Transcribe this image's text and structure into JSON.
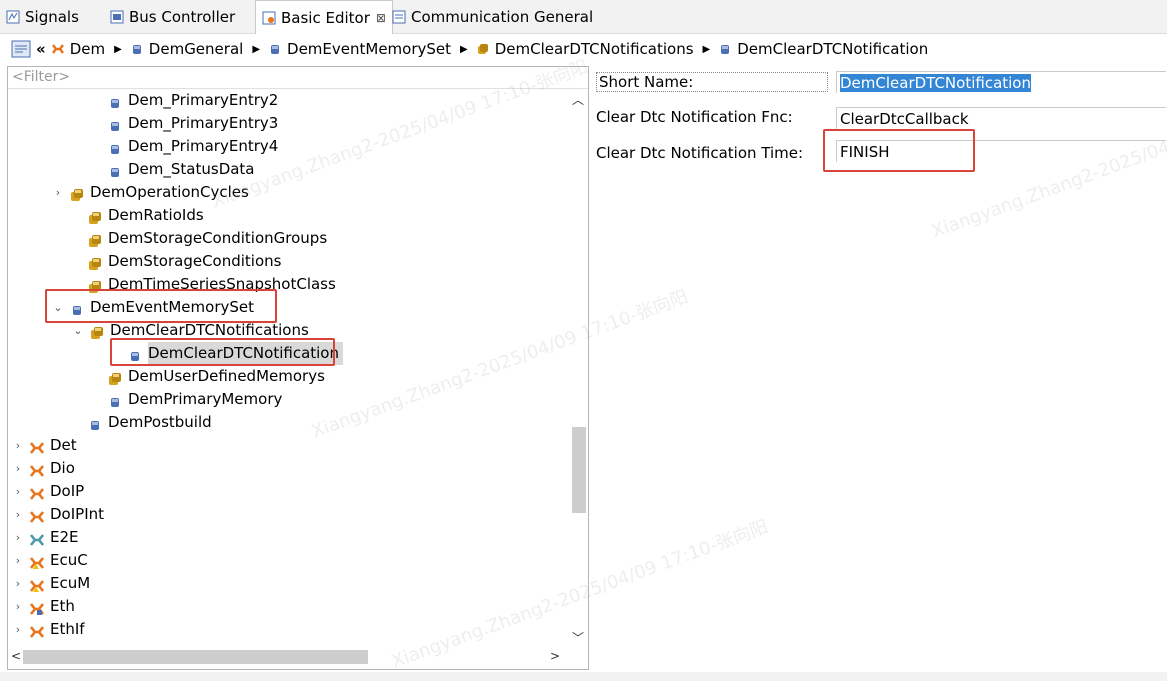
{
  "tabs": [
    {
      "label": "Signals"
    },
    {
      "label": "Bus Controller"
    },
    {
      "label": "Basic Editor",
      "close": "⊠"
    },
    {
      "label": "Communication General"
    }
  ],
  "breadcrumb": {
    "back": "«",
    "items": [
      "Dem",
      "DemGeneral",
      "DemEventMemorySet",
      "DemClearDTCNotifications",
      "DemClearDTCNotification"
    ]
  },
  "filter": {
    "placeholder": "<Filter>"
  },
  "tree": [
    {
      "label": "Dem_PrimaryEntry2"
    },
    {
      "label": "Dem_PrimaryEntry3"
    },
    {
      "label": "Dem_PrimaryEntry4"
    },
    {
      "label": "Dem_StatusData"
    },
    {
      "label": "DemOperationCycles"
    },
    {
      "label": "DemRatioIds"
    },
    {
      "label": "DemStorageConditionGroups"
    },
    {
      "label": "DemStorageConditions"
    },
    {
      "label": "DemTimeSeriesSnapshotClass"
    },
    {
      "label": "DemEventMemorySet"
    },
    {
      "label": "DemClearDTCNotifications"
    },
    {
      "label": "DemClearDTCNotification"
    },
    {
      "label": "DemUserDefinedMemorys"
    },
    {
      "label": "DemPrimaryMemory"
    },
    {
      "label": "DemPostbuild"
    },
    {
      "label": "Det"
    },
    {
      "label": "Dio"
    },
    {
      "label": "DoIP"
    },
    {
      "label": "DoIPInt"
    },
    {
      "label": "E2E"
    },
    {
      "label": "EcuC"
    },
    {
      "label": "EcuM"
    },
    {
      "label": "Eth"
    },
    {
      "label": "EthIf"
    }
  ],
  "form": {
    "short_name_label": "Short Name:",
    "short_name_value": "DemClearDTCNotification",
    "fnc_label": "Clear Dtc Notification Fnc:",
    "fnc_value": "ClearDtcCallback",
    "time_label": "Clear Dtc Notification Time:",
    "time_value": "FINISH"
  },
  "watermark": "Xiangyang.Zhang2-2025/04/09 17:10-张向阳",
  "colors": {
    "highlight": "#d9433a",
    "selection": "#3385d6",
    "module_icon": "#e8741c",
    "container_icon": "#d6a21e",
    "param_icon": "#4a6fb5"
  }
}
